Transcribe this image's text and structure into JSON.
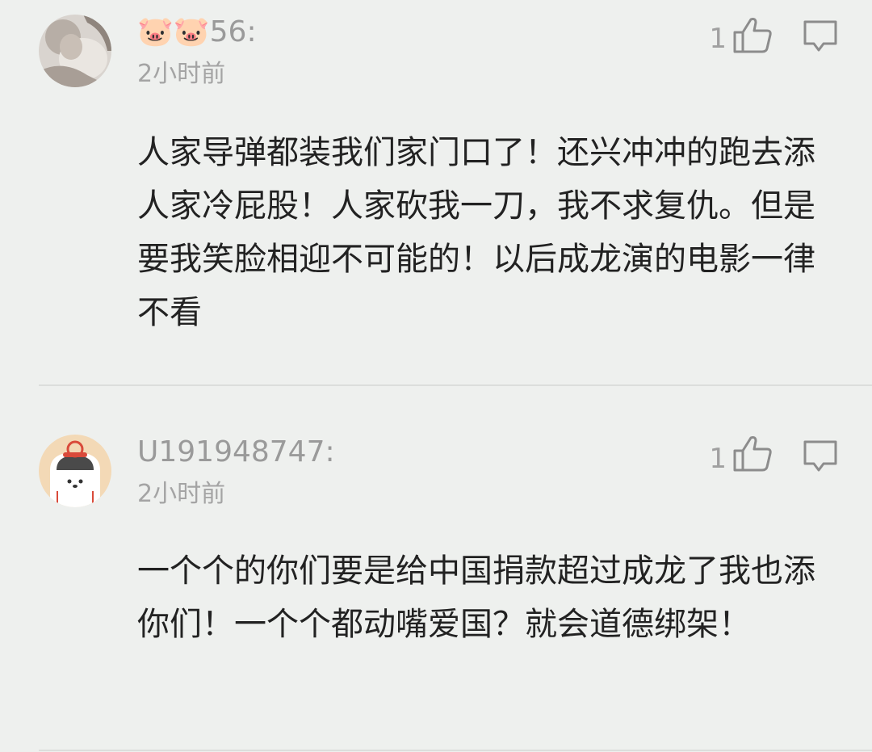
{
  "comments": [
    {
      "username": "🐷🐷56:",
      "time": "2小时前",
      "likes": "1",
      "content": "人家导弹都装我们家门口了！还兴冲冲的跑去添人家冷屁股！人家砍我一刀，我不求复仇。但是要我笑脸相迎不可能的！以后成龙演的电影一律不看",
      "avatar_icon": "user-photo-avatar"
    },
    {
      "username": "U191948747:",
      "time": "2小时前",
      "likes": "1",
      "content": "一个个的你们要是给中国捐款超过成龙了我也添你们！一个个都动嘴爱国？就会道德绑架！",
      "avatar_icon": "cartoon-bear-avatar"
    }
  ],
  "icons": {
    "like": "thumbs-up-icon",
    "reply": "comment-bubble-icon"
  },
  "colors": {
    "background": "#eef0ee",
    "text_primary": "#222222",
    "text_secondary": "#9a9a9a",
    "icon": "#8c8c8c"
  }
}
